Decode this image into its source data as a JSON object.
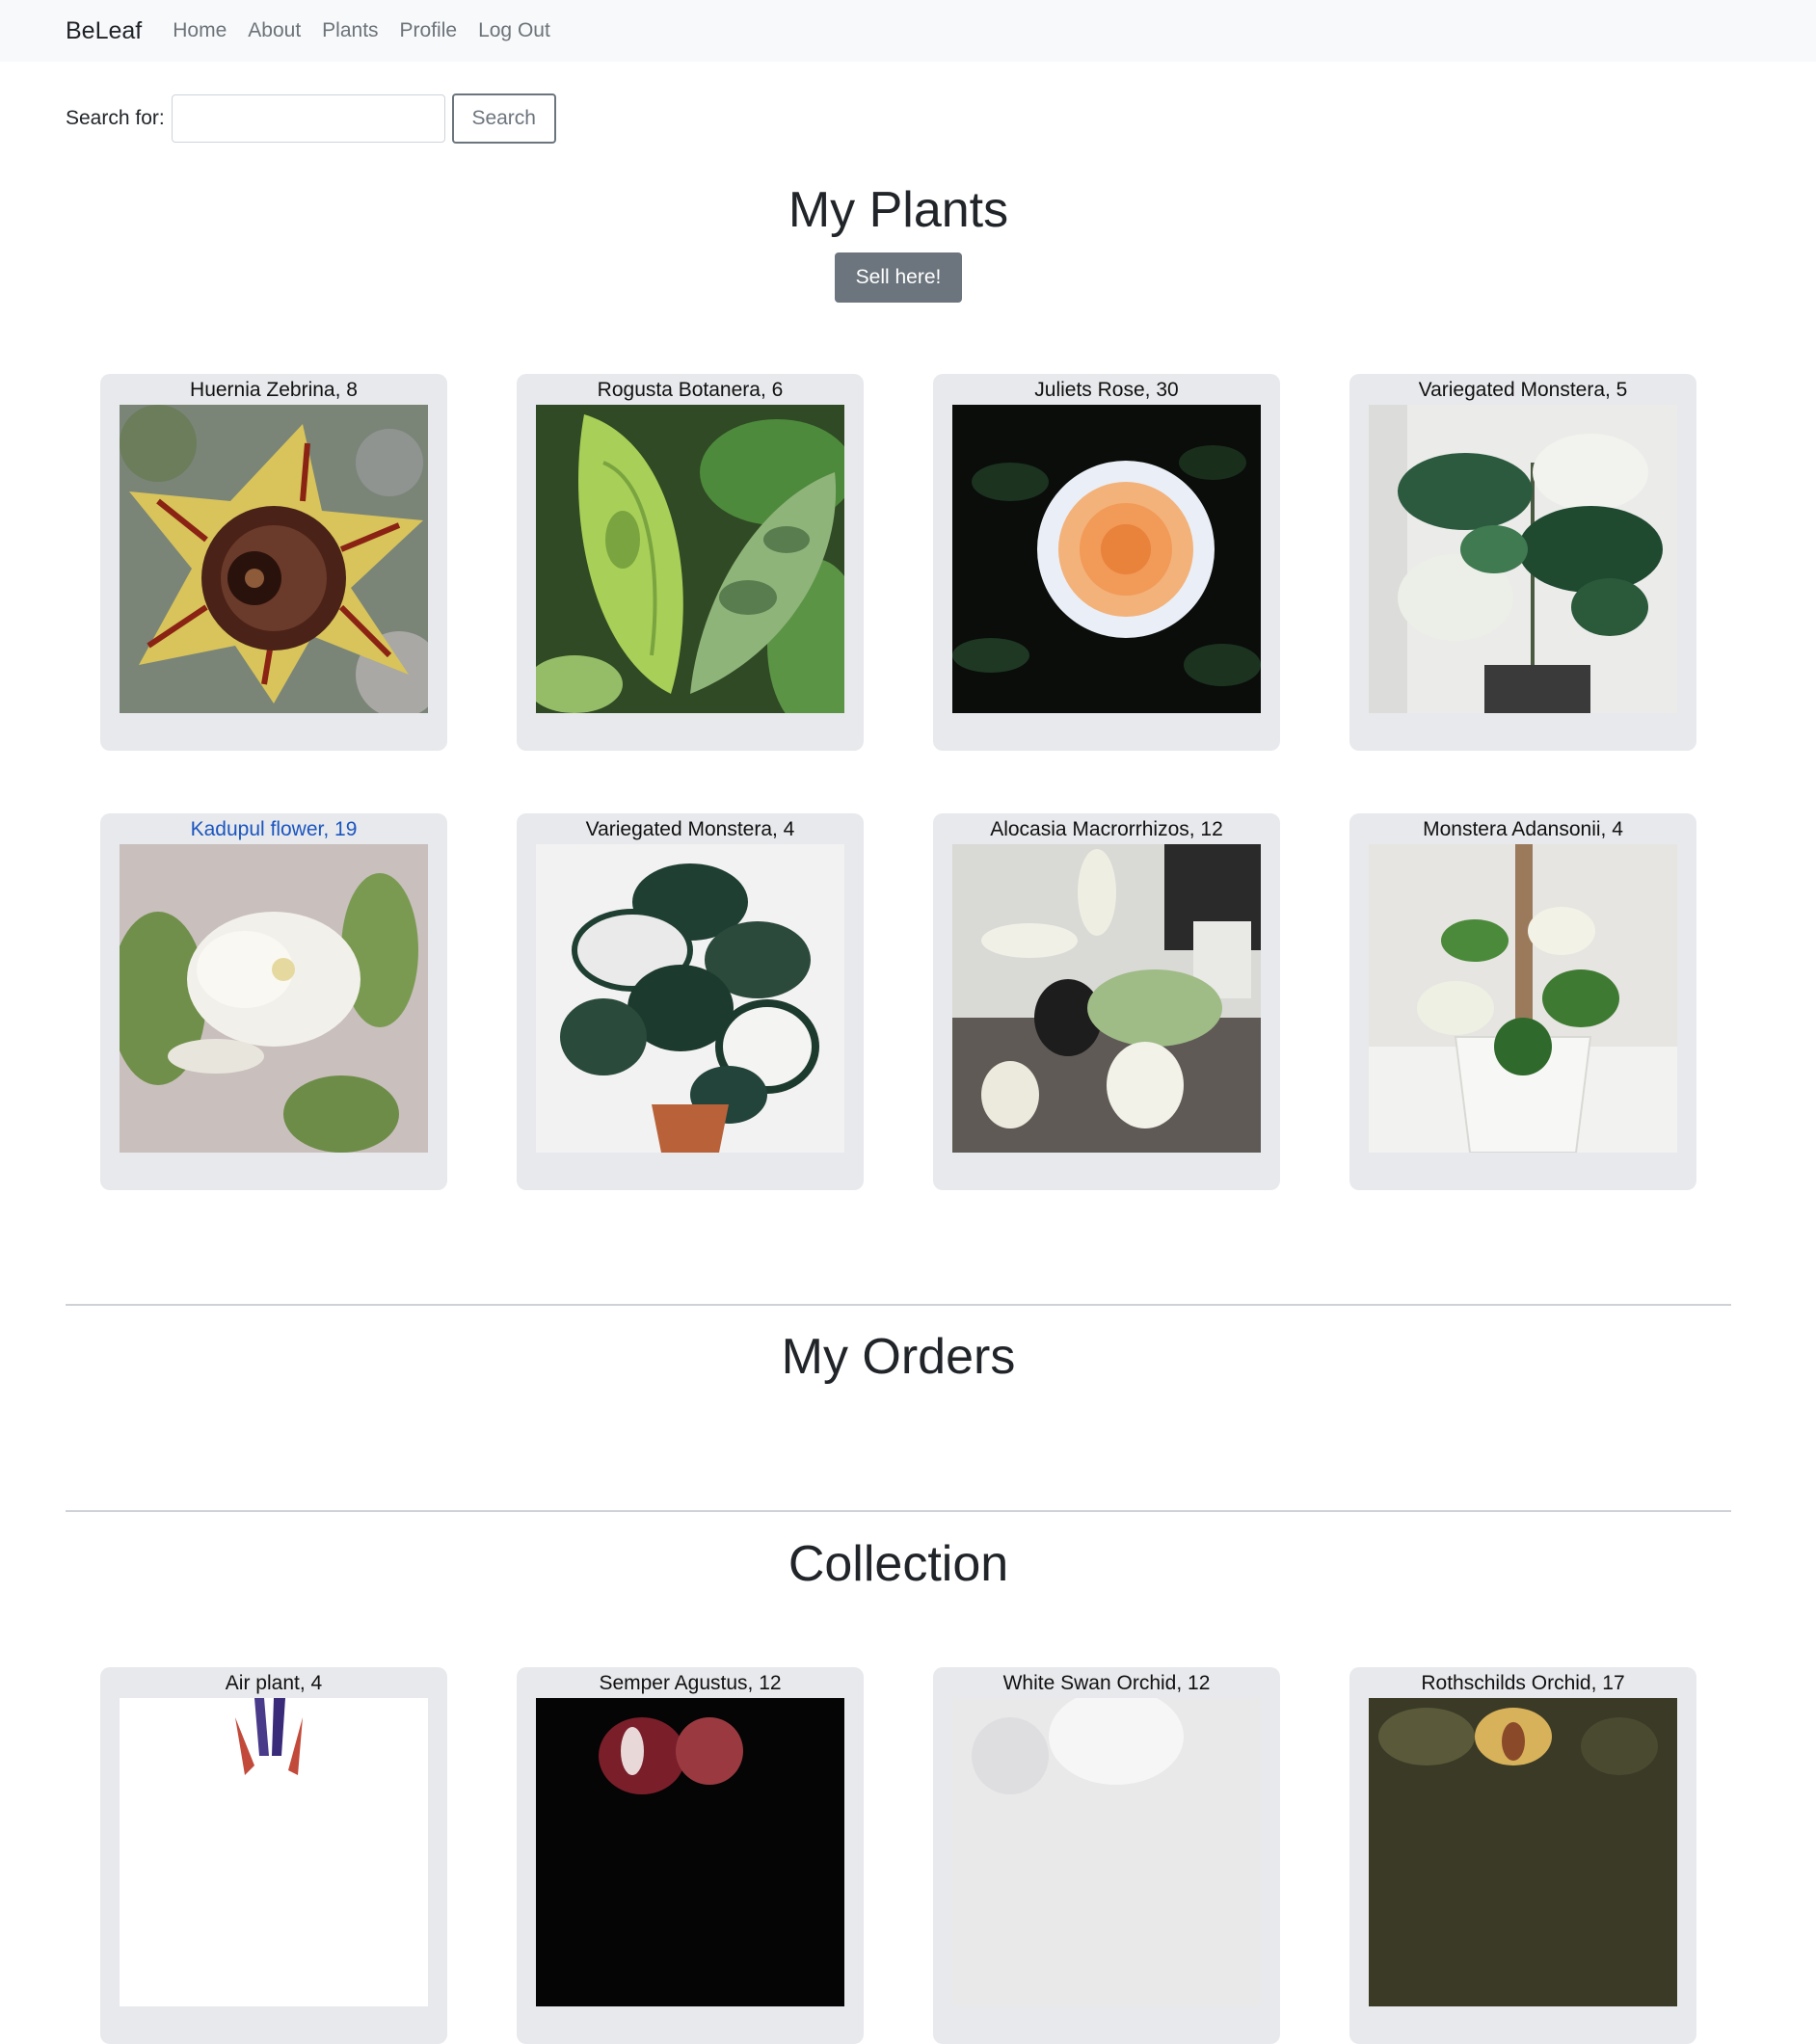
{
  "nav": {
    "brand": "BeLeaf",
    "links": [
      "Home",
      "About",
      "Plants",
      "Profile",
      "Log Out"
    ]
  },
  "search": {
    "label": "Search for:",
    "value": "",
    "placeholder": "",
    "button": "Search"
  },
  "my_plants": {
    "title": "My Plants",
    "sell_button": "Sell here!",
    "cards": [
      {
        "title": "Huernia Zebrina, 8",
        "image": "huernia-zebrina-photo"
      },
      {
        "title": "Rogusta Botanera, 6",
        "image": "rogusta-botanera-photo"
      },
      {
        "title": "Juliets Rose, 30",
        "image": "juliets-rose-photo"
      },
      {
        "title": "Variegated Monstera, 5",
        "image": "variegated-monstera-photo"
      },
      {
        "title": "Kadupul flower, 19",
        "image": "kadupul-flower-photo",
        "link": true
      },
      {
        "title": "Variegated Monstera, 4",
        "image": "variegated-monstera-photo"
      },
      {
        "title": "Alocasia Macrorrhizos, 12",
        "image": "alocasia-photo"
      },
      {
        "title": "Monstera Adansonii, 4",
        "image": "monstera-adansonii-photo"
      }
    ]
  },
  "my_orders": {
    "title": "My Orders"
  },
  "collection": {
    "title": "Collection",
    "cards": [
      {
        "title": "Air plant, 4",
        "image": "air-plant-photo"
      },
      {
        "title": "Semper Agustus, 12",
        "image": "semper-agustus-photo"
      },
      {
        "title": "White Swan Orchid, 12",
        "image": "white-swan-orchid-photo"
      },
      {
        "title": "Rothschilds Orchid, 17",
        "image": "rothschilds-orchid-photo"
      }
    ]
  },
  "colors": {
    "link_blue": "#1a55c0",
    "card_bg": "#e8e9ec",
    "secondary": "#6c757d"
  }
}
